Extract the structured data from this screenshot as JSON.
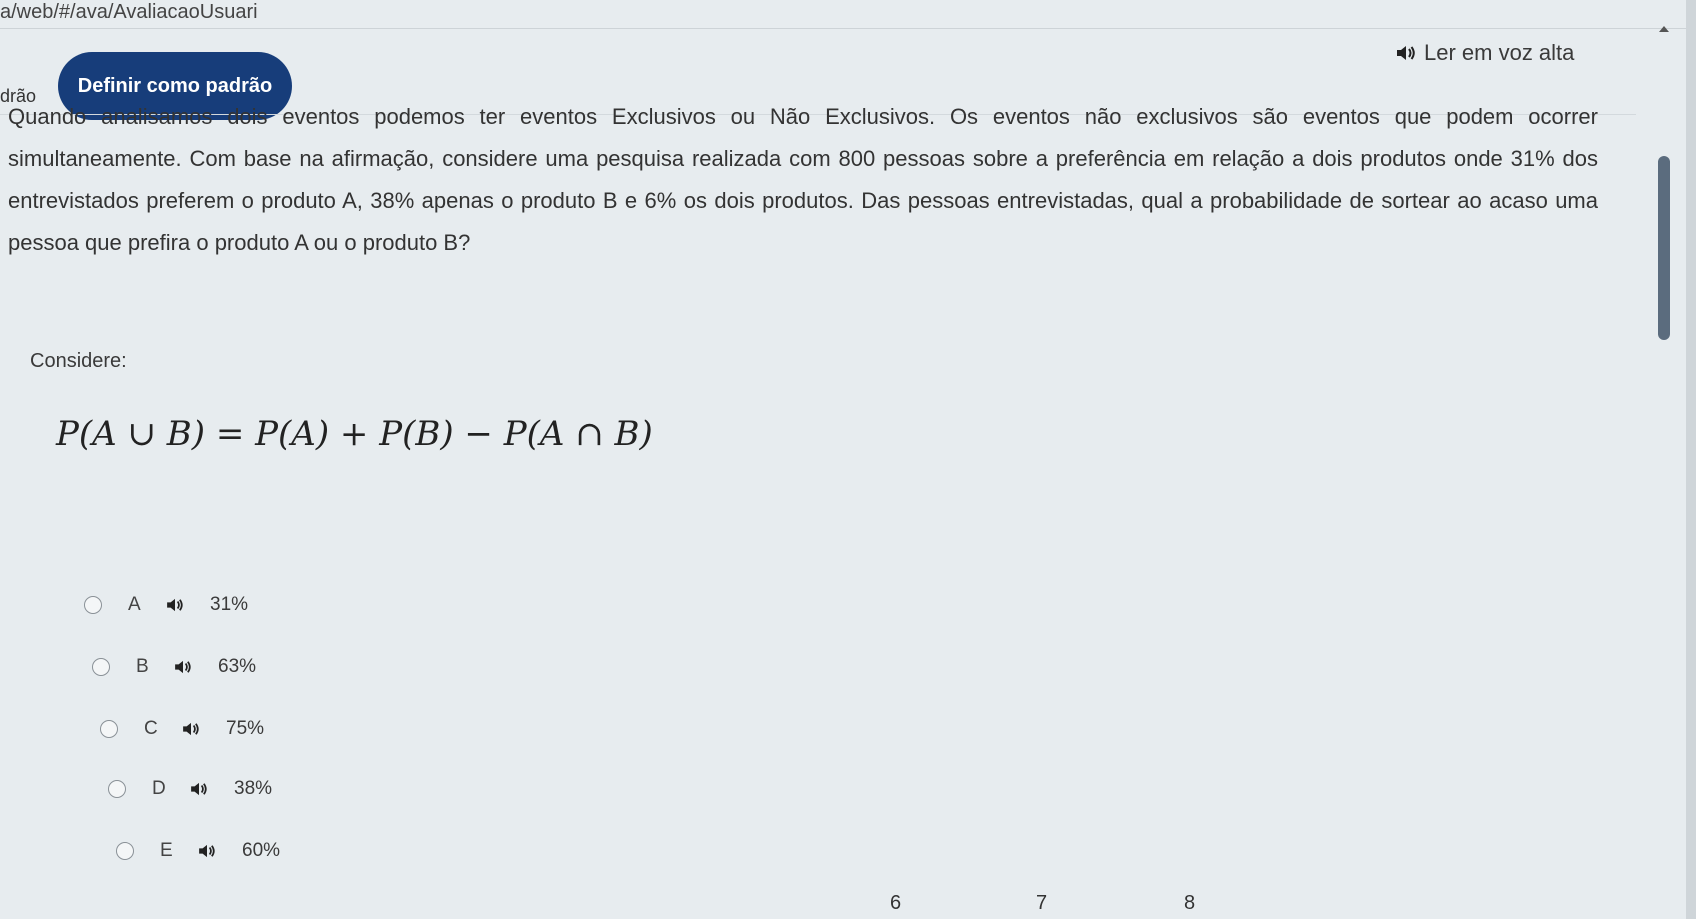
{
  "browser": {
    "url": "a/web/#/ava/AvaliacaoUsuari"
  },
  "toolbar": {
    "prev_label": "drão",
    "default_button": "Definir como padrão",
    "read_aloud": "Ler em voz alta"
  },
  "question": {
    "text": "Quando analisamos dois eventos podemos ter eventos Exclusivos ou Não Exclusivos. Os eventos não exclusivos são eventos que podem ocorrer simultaneamente. Com base na afirmação, considere uma pesquisa realizada com 800 pessoas sobre a preferência em relação a dois produtos onde 31% dos entrevistados preferem o produto A, 38% apenas o produto B e 6% os dois produtos. Das pessoas entrevistadas, qual a probabilidade de sortear ao acaso uma pessoa que prefira o produto A ou o produto B?",
    "consider": "Considere:",
    "formula": "P(A ∪ B) = P(A) + P(B) − P(A ∩ B)"
  },
  "options": [
    {
      "letter": "A",
      "value": "31%"
    },
    {
      "letter": "B",
      "value": "63%"
    },
    {
      "letter": "C",
      "value": "75%"
    },
    {
      "letter": "D",
      "value": "38%"
    },
    {
      "letter": "E",
      "value": "60%"
    }
  ],
  "pagination": [
    "6",
    "7",
    "8"
  ],
  "colors": {
    "primary_button": "#173d7a",
    "background": "#e7ecef",
    "scrollbar": "#5b6c7e"
  },
  "icons": {
    "read_aloud": "speaker-icon",
    "option_audio": "speaker-icon",
    "scroll": "caret-up-icon"
  }
}
